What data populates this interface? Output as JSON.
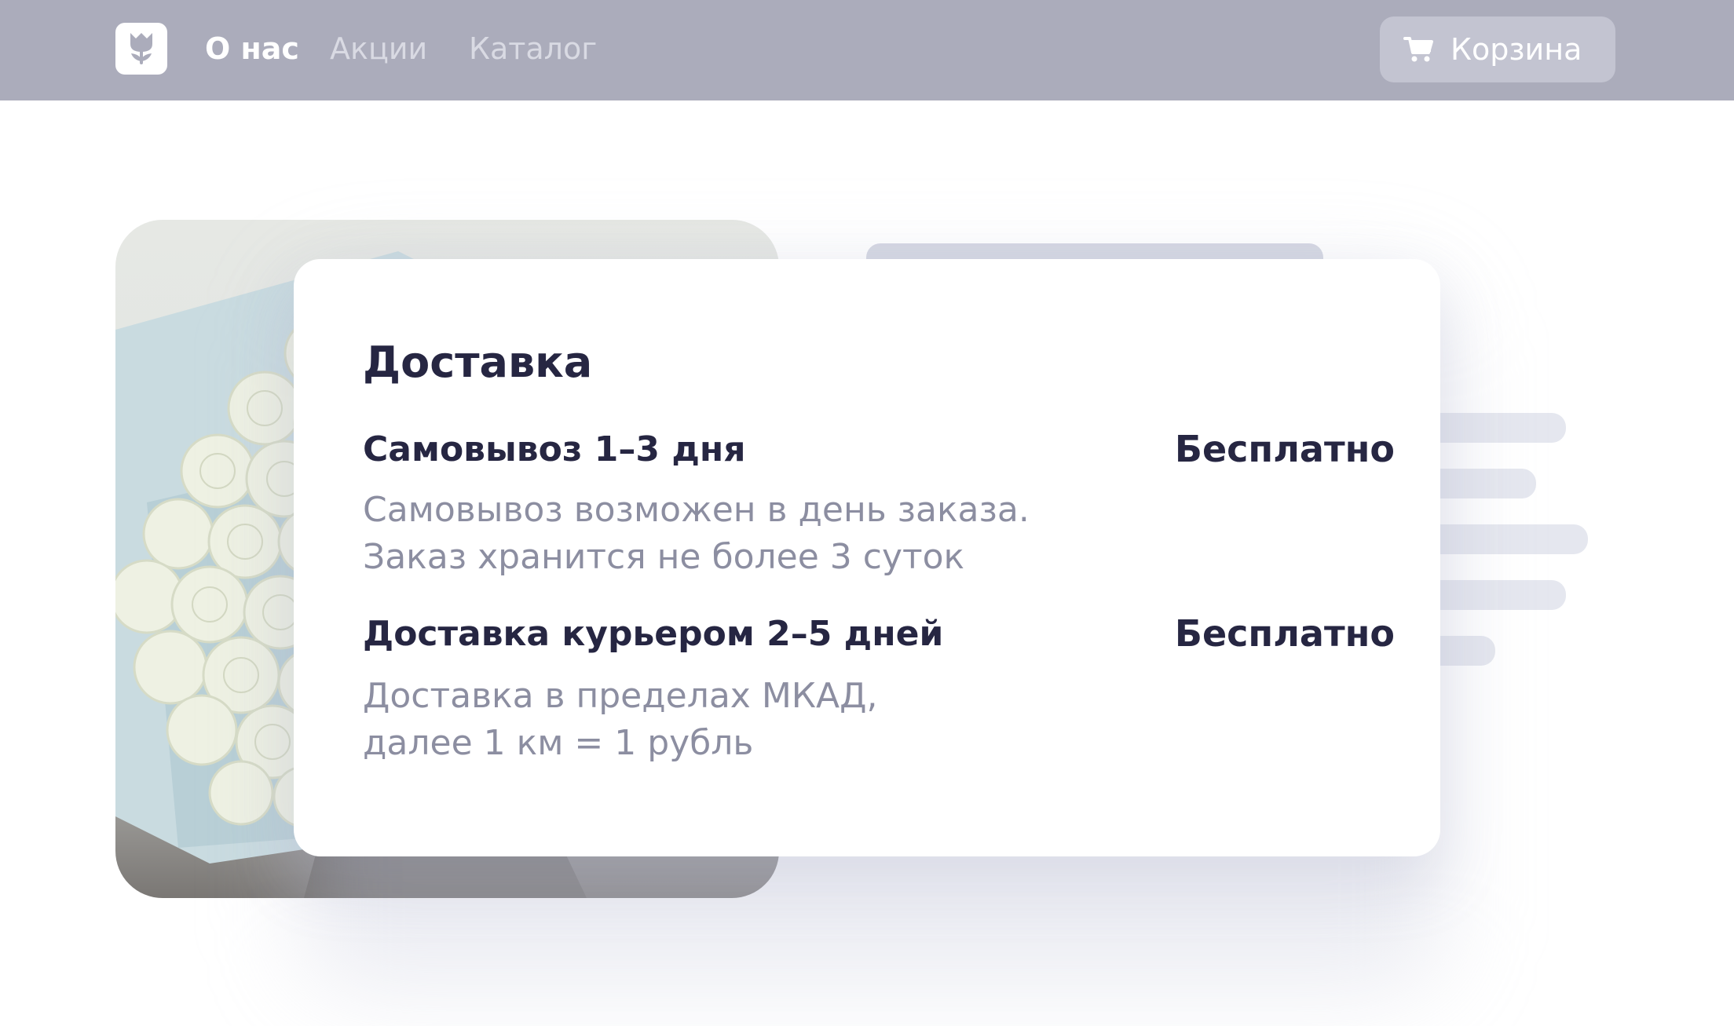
{
  "header": {
    "logo_icon": "tulip-icon",
    "nav": [
      {
        "label": "О нас",
        "active": true
      },
      {
        "label": "Акции",
        "active": false
      },
      {
        "label": "Каталог",
        "active": false
      }
    ],
    "cart": {
      "icon": "cart-icon",
      "label": "Корзина"
    }
  },
  "delivery": {
    "title": "Доставка",
    "options": [
      {
        "title": "Самовывоз 1–3 дня",
        "price": "Бесплатно",
        "description": [
          "Самовывоз возможен в день заказа.",
          "Заказ хранится не более 3 суток"
        ]
      },
      {
        "title": "Доставка курьером 2–5 дней",
        "price": "Бесплатно",
        "description": [
          "Доставка в пределах МКАД,",
          "далее 1 км = 1 рубль"
        ]
      }
    ]
  },
  "colors": {
    "header_bg": "#abacbb",
    "text_dark": "#262642",
    "text_muted": "#8c8ea1",
    "placeholder": "#e5e7ef"
  }
}
